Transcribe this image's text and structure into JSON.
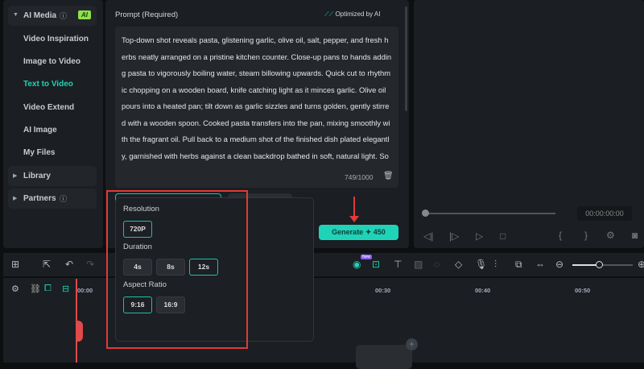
{
  "sidebar": {
    "ai_media": {
      "label": "AI Media",
      "badge": "AI"
    },
    "items": [
      {
        "label": "Video Inspiration"
      },
      {
        "label": "Image to Video"
      },
      {
        "label": "Text to Video",
        "active": true
      },
      {
        "label": "Video Extend"
      },
      {
        "label": "AI Image"
      },
      {
        "label": "My Files"
      }
    ],
    "library": "Library",
    "partners": "Partners"
  },
  "prompt": {
    "label": "Prompt (Required)",
    "optimized": "Optimized by AI",
    "text": "Top-down shot reveals pasta, glistening garlic, olive oil, salt, pepper, and fresh herbs neatly arranged on a pristine kitchen counter. Close-up pans to hands adding pasta to vigorously boiling water, steam billowing upwards. Quick cut to rhythmic chopping on a wooden board, knife catching light as it minces garlic. Olive oil pours into a heated pan; tilt down as garlic sizzles and turns golden, gently stirred with a wooden spoon. Cooked pasta transfers into the pan, mixing smoothly with the fragrant oil. Pull back to a medium shot of the finished dish plated elegantly, garnished with herbs against a clean backdrop bathed in soft, natural light. So",
    "count": "749/1000"
  },
  "settings": {
    "resolution_label": "Resolution",
    "resolutions": [
      "720P"
    ],
    "duration_label": "Duration",
    "durations": [
      "4s",
      "8s",
      "12s"
    ],
    "selected_duration": "12s",
    "aspect_label": "Aspect Ratio",
    "aspects": [
      "9:16",
      "16:9"
    ],
    "selected_aspect": "9:16"
  },
  "generate": {
    "label": "Generate",
    "credits": "450"
  },
  "preview": {
    "timecode": "00:00:00:00"
  },
  "toolbar": {
    "new_badge": "New"
  },
  "ruler": [
    "00:00",
    "00:30",
    "00:40",
    "00:50"
  ],
  "colors": {
    "accent": "#1fd3b8",
    "highlight": "#e03a3a"
  }
}
